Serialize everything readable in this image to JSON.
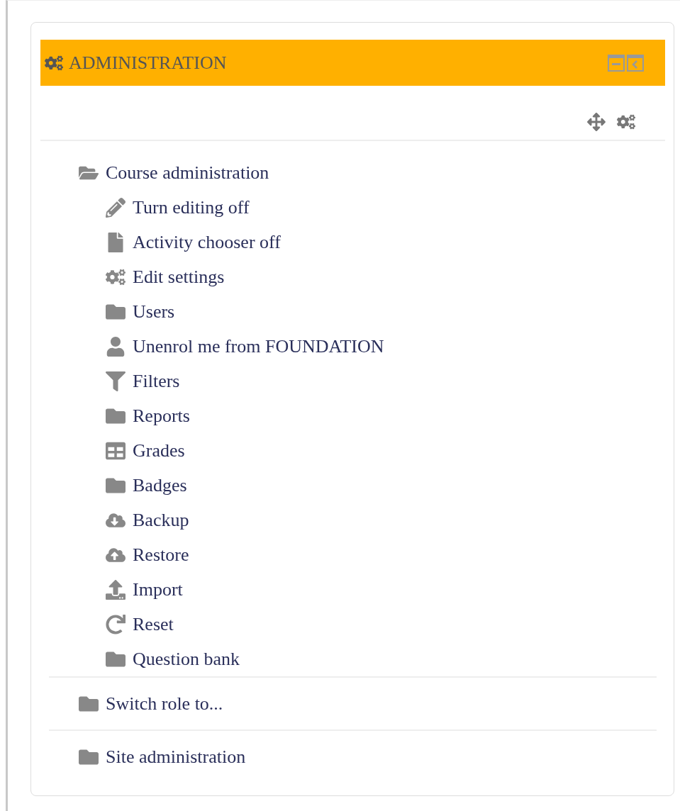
{
  "block": {
    "title": "ADMINISTRATION"
  },
  "tree": [
    {
      "label": "Course administration",
      "kind": "folder",
      "expanded": true,
      "children": [
        {
          "label": "Turn editing off",
          "kind": "pencil"
        },
        {
          "label": "Activity chooser off",
          "kind": "file"
        },
        {
          "label": "Edit settings",
          "kind": "gears"
        },
        {
          "label": "Users",
          "kind": "folder"
        },
        {
          "label": "Unenrol me from FOUNDATION",
          "kind": "user"
        },
        {
          "label": "Filters",
          "kind": "filter"
        },
        {
          "label": "Reports",
          "kind": "folder"
        },
        {
          "label": "Grades",
          "kind": "grid"
        },
        {
          "label": "Badges",
          "kind": "folder"
        },
        {
          "label": "Backup",
          "kind": "cloud-down"
        },
        {
          "label": "Restore",
          "kind": "cloud-up"
        },
        {
          "label": "Import",
          "kind": "upload"
        },
        {
          "label": "Reset",
          "kind": "reset"
        },
        {
          "label": "Question bank",
          "kind": "folder"
        }
      ]
    },
    {
      "label": "Switch role to...",
      "kind": "folder",
      "expanded": false
    },
    {
      "label": "Site administration",
      "kind": "folder",
      "expanded": false
    }
  ]
}
